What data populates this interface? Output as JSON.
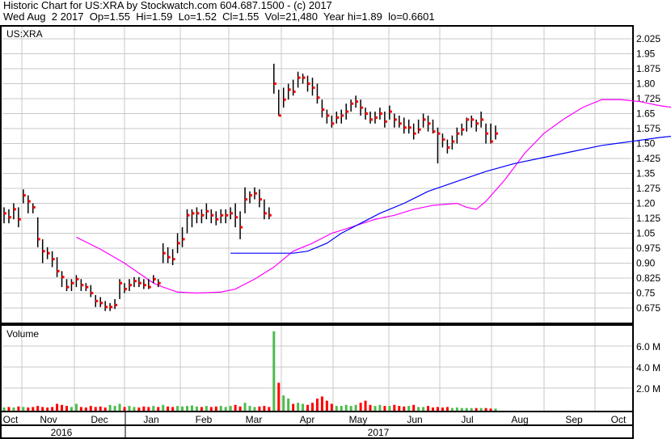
{
  "header": {
    "line1": "Historic Chart for US:XRA by Stockwatch.com 604.687.1500 - (c) 2017",
    "line2": "Wed Aug  2 2017  Op=1.55  Hi=1.59  Lo=1.52  Cl=1.55  Vol=21,480  Year hi=1.89  lo=0.6601"
  },
  "colors": {
    "up": "#4cbb4c",
    "down": "#ff0000",
    "bar": "#000000",
    "ma_short": "#ff00ff",
    "ma_long": "#0000ff",
    "grid": "#c8c8c8"
  },
  "chart_data": {
    "type": "ohlc",
    "symbol": "US:XRA",
    "price_ticks": [
      "2.025",
      "1.95",
      "1.875",
      "1.80",
      "1.725",
      "1.65",
      "1.575",
      "1.50",
      "1.425",
      "1.35",
      "1.275",
      "1.20",
      "1.125",
      "1.05",
      "0.975",
      "0.90",
      "0.825",
      "0.75",
      "0.675"
    ],
    "ylim": [
      0.6,
      2.1
    ],
    "volume_label": "Volume",
    "volume_ticks": [
      "6.0 M",
      "4.0 M",
      "2.0 M"
    ],
    "volume_ticks_values": [
      6,
      4,
      2
    ],
    "months": [
      "Oct",
      "Nov",
      "Dec",
      "Jan",
      "Feb",
      "Mar",
      "Apr",
      "May",
      "Jun",
      "Jul",
      "Aug",
      "Sep",
      "Oct"
    ],
    "years": [
      "2016",
      "2017"
    ],
    "bars_hlc": [
      [
        1.18,
        1.1,
        1.15
      ],
      [
        1.17,
        1.1,
        1.13
      ],
      [
        1.2,
        1.12,
        1.17
      ],
      [
        1.18,
        1.08,
        1.12
      ],
      [
        1.27,
        1.2,
        1.24
      ],
      [
        1.24,
        1.15,
        1.21
      ],
      [
        1.2,
        1.15,
        1.18
      ],
      [
        1.13,
        0.98,
        1.02
      ],
      [
        1.02,
        0.9,
        0.96
      ],
      [
        0.98,
        0.92,
        0.95
      ],
      [
        0.96,
        0.88,
        0.92
      ],
      [
        0.93,
        0.83,
        0.86
      ],
      [
        0.86,
        0.78,
        0.83
      ],
      [
        0.82,
        0.76,
        0.78
      ],
      [
        0.82,
        0.76,
        0.8
      ],
      [
        0.84,
        0.78,
        0.82
      ],
      [
        0.82,
        0.76,
        0.79
      ],
      [
        0.8,
        0.76,
        0.78
      ],
      [
        0.79,
        0.73,
        0.75
      ],
      [
        0.74,
        0.68,
        0.71
      ],
      [
        0.73,
        0.68,
        0.7
      ],
      [
        0.71,
        0.66,
        0.68
      ],
      [
        0.7,
        0.66,
        0.68
      ],
      [
        0.72,
        0.67,
        0.69
      ],
      [
        0.82,
        0.72,
        0.8
      ],
      [
        0.8,
        0.75,
        0.77
      ],
      [
        0.82,
        0.76,
        0.79
      ],
      [
        0.83,
        0.78,
        0.81
      ],
      [
        0.83,
        0.78,
        0.8
      ],
      [
        0.82,
        0.77,
        0.79
      ],
      [
        0.82,
        0.77,
        0.78
      ],
      [
        0.84,
        0.8,
        0.82
      ],
      [
        0.82,
        0.78,
        0.8
      ],
      [
        1.0,
        0.9,
        0.95
      ],
      [
        0.98,
        0.9,
        0.93
      ],
      [
        0.97,
        0.89,
        0.92
      ],
      [
        1.05,
        0.95,
        1.0
      ],
      [
        1.08,
        0.98,
        1.02
      ],
      [
        1.17,
        1.05,
        1.14
      ],
      [
        1.17,
        1.08,
        1.15
      ],
      [
        1.18,
        1.1,
        1.15
      ],
      [
        1.17,
        1.1,
        1.14
      ],
      [
        1.2,
        1.12,
        1.16
      ],
      [
        1.17,
        1.1,
        1.14
      ],
      [
        1.16,
        1.09,
        1.12
      ],
      [
        1.17,
        1.1,
        1.14
      ],
      [
        1.17,
        1.1,
        1.14
      ],
      [
        1.18,
        1.12,
        1.15
      ],
      [
        1.2,
        1.08,
        1.13
      ],
      [
        1.16,
        1.02,
        1.08
      ],
      [
        1.28,
        1.15,
        1.22
      ],
      [
        1.26,
        1.2,
        1.24
      ],
      [
        1.28,
        1.22,
        1.25
      ],
      [
        1.27,
        1.18,
        1.22
      ],
      [
        1.22,
        1.12,
        1.15
      ],
      [
        1.18,
        1.12,
        1.14
      ],
      [
        1.9,
        1.75,
        1.8
      ],
      [
        1.77,
        1.64,
        1.64
      ],
      [
        1.78,
        1.68,
        1.72
      ],
      [
        1.8,
        1.72,
        1.77
      ],
      [
        1.82,
        1.74,
        1.76
      ],
      [
        1.86,
        1.78,
        1.83
      ],
      [
        1.85,
        1.8,
        1.83
      ],
      [
        1.84,
        1.76,
        1.8
      ],
      [
        1.83,
        1.74,
        1.78
      ],
      [
        1.8,
        1.7,
        1.73
      ],
      [
        1.72,
        1.63,
        1.67
      ],
      [
        1.67,
        1.6,
        1.64
      ],
      [
        1.64,
        1.58,
        1.6
      ],
      [
        1.66,
        1.6,
        1.63
      ],
      [
        1.67,
        1.6,
        1.64
      ],
      [
        1.7,
        1.62,
        1.66
      ],
      [
        1.72,
        1.66,
        1.7
      ],
      [
        1.74,
        1.68,
        1.71
      ],
      [
        1.72,
        1.64,
        1.68
      ],
      [
        1.68,
        1.62,
        1.65
      ],
      [
        1.66,
        1.6,
        1.62
      ],
      [
        1.66,
        1.6,
        1.63
      ],
      [
        1.68,
        1.62,
        1.65
      ],
      [
        1.66,
        1.58,
        1.61
      ],
      [
        1.69,
        1.62,
        1.66
      ],
      [
        1.65,
        1.58,
        1.62
      ],
      [
        1.64,
        1.58,
        1.6
      ],
      [
        1.63,
        1.55,
        1.58
      ],
      [
        1.62,
        1.55,
        1.58
      ],
      [
        1.6,
        1.52,
        1.55
      ],
      [
        1.62,
        1.55,
        1.57
      ],
      [
        1.65,
        1.58,
        1.62
      ],
      [
        1.64,
        1.56,
        1.6
      ],
      [
        1.62,
        1.55,
        1.56
      ],
      [
        1.58,
        1.4,
        1.55
      ],
      [
        1.55,
        1.48,
        1.52
      ],
      [
        1.52,
        1.45,
        1.48
      ],
      [
        1.54,
        1.47,
        1.51
      ],
      [
        1.58,
        1.5,
        1.55
      ],
      [
        1.6,
        1.54,
        1.57
      ],
      [
        1.63,
        1.56,
        1.62
      ],
      [
        1.64,
        1.58,
        1.62
      ],
      [
        1.62,
        1.56,
        1.6
      ],
      [
        1.66,
        1.58,
        1.62
      ],
      [
        1.6,
        1.5,
        1.55
      ],
      [
        1.6,
        1.5,
        1.51
      ],
      [
        1.59,
        1.52,
        1.55
      ]
    ],
    "volume_millions": [
      0.15,
      0.2,
      0.15,
      0.25,
      0.2,
      0.15,
      0.2,
      0.3,
      0.2,
      0.15,
      0.2,
      0.5,
      0.4,
      0.3,
      0.2,
      0.5,
      0.2,
      0.15,
      0.3,
      0.2,
      0.25,
      0.15,
      0.4,
      0.3,
      0.5,
      0.2,
      0.3,
      0.2,
      0.15,
      0.25,
      0.2,
      0.3,
      0.2,
      0.4,
      0.25,
      0.2,
      0.3,
      0.25,
      0.3,
      0.35,
      0.25,
      0.2,
      0.3,
      0.2,
      0.25,
      0.3,
      0.2,
      0.3,
      0.4,
      0.25,
      0.6,
      0.3,
      0.2,
      0.25,
      0.3,
      0.2,
      7.4,
      2.5,
      1.3,
      1.0,
      0.5,
      0.6,
      0.5,
      0.4,
      0.6,
      1.0,
      1.2,
      0.8,
      0.5,
      0.3,
      0.3,
      0.4,
      0.3,
      0.4,
      0.6,
      0.8,
      0.4,
      0.3,
      0.4,
      0.3,
      0.3,
      0.4,
      0.3,
      0.25,
      0.3,
      0.4,
      0.2,
      0.2,
      0.3,
      0.15,
      0.2,
      0.15,
      0.2,
      0.1,
      0.15,
      0.1,
      0.1,
      0.1,
      0.1,
      0.1,
      0.1,
      0.05,
      0.05
    ],
    "ma_short": [
      [
        15,
        1.03
      ],
      [
        20,
        0.97
      ],
      [
        25,
        0.9
      ],
      [
        28,
        0.85
      ],
      [
        31,
        0.8
      ],
      [
        33,
        0.78
      ],
      [
        36,
        0.755
      ],
      [
        40,
        0.75
      ],
      [
        45,
        0.755
      ],
      [
        48,
        0.77
      ],
      [
        52,
        0.82
      ],
      [
        56,
        0.88
      ],
      [
        60,
        0.96
      ],
      [
        64,
        1.0
      ],
      [
        68,
        1.05
      ],
      [
        72,
        1.08
      ],
      [
        77,
        1.12
      ],
      [
        81,
        1.14
      ],
      [
        85,
        1.17
      ],
      [
        89,
        1.19
      ],
      [
        94,
        1.2
      ],
      [
        96,
        1.18
      ],
      [
        98,
        1.17
      ],
      [
        100,
        1.21
      ],
      [
        104,
        1.32
      ],
      [
        108,
        1.45
      ],
      [
        112,
        1.55
      ],
      [
        116,
        1.62
      ],
      [
        120,
        1.68
      ],
      [
        124,
        1.72
      ],
      [
        128,
        1.72
      ],
      [
        132,
        1.71
      ],
      [
        136,
        1.69
      ],
      [
        142,
        1.67
      ],
      [
        148,
        1.65
      ],
      [
        154,
        1.63
      ],
      [
        160,
        1.62
      ],
      [
        166,
        1.61
      ],
      [
        172,
        1.59
      ],
      [
        178,
        1.58
      ],
      [
        184,
        1.575
      ],
      [
        190,
        1.57
      ],
      [
        196,
        1.575
      ],
      [
        201,
        1.57
      ]
    ],
    "ma_long": [
      [
        47,
        0.95
      ],
      [
        51,
        0.95
      ],
      [
        55,
        0.95
      ],
      [
        60,
        0.95
      ],
      [
        63,
        0.96
      ],
      [
        67,
        1.0
      ],
      [
        70,
        1.05
      ],
      [
        74,
        1.1
      ],
      [
        78,
        1.15
      ],
      [
        83,
        1.2
      ],
      [
        88,
        1.26
      ],
      [
        94,
        1.31
      ],
      [
        100,
        1.36
      ],
      [
        106,
        1.4
      ],
      [
        112,
        1.43
      ],
      [
        118,
        1.46
      ],
      [
        124,
        1.49
      ],
      [
        130,
        1.51
      ],
      [
        136,
        1.53
      ],
      [
        142,
        1.545
      ],
      [
        150,
        1.555
      ],
      [
        160,
        1.575
      ],
      [
        170,
        1.59
      ],
      [
        180,
        1.605
      ],
      [
        190,
        1.625
      ],
      [
        201,
        1.64
      ]
    ],
    "ma_index_units": "bar index"
  }
}
